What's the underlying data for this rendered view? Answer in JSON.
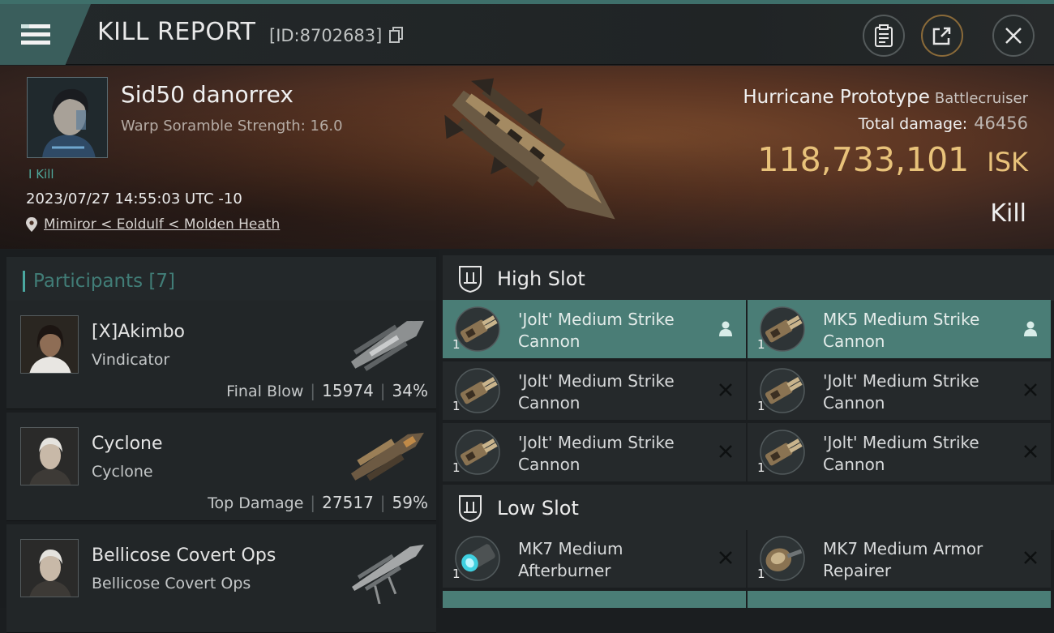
{
  "header": {
    "title": "KILL REPORT",
    "report_id": "[ID:8702683]",
    "icons": [
      "menu-icon",
      "copy-icon",
      "clipboard-icon",
      "share-icon",
      "close-icon"
    ]
  },
  "victim": {
    "name": "Sid50 danorrex",
    "scramble": "Warp Soramble Strength: 16.0",
    "kill_count": "I Kill",
    "time": "2023/07/27 14:55:03 UTC -10",
    "location": "Mimiror < Eoldulf < Molden Heath",
    "ship_name": "Hurricane Prototype",
    "ship_class": "Battlecruiser",
    "total_damage_label": "Total damage:",
    "total_damage": "46456",
    "isk_value": "118,733,101",
    "isk_unit": "ISK",
    "result": "Kill"
  },
  "participants": {
    "title": "Participants [7]",
    "rows": [
      {
        "name": "[X]Akimbo",
        "ship": "Vindicator",
        "label": "Final Blow",
        "damage": "15974",
        "pct": "34%"
      },
      {
        "name": "Cyclone",
        "ship": "Cyclone",
        "label": "Top Damage",
        "damage": "27517",
        "pct": "59%"
      },
      {
        "name": "Bellicose Covert Ops",
        "ship": "Bellicose Covert Ops"
      }
    ]
  },
  "slots": {
    "high": {
      "label": "High Slot",
      "modules": [
        {
          "qty": "1",
          "line1": "'Jolt' Medium Strike",
          "line2": "Cannon",
          "flag": "person-icon"
        },
        {
          "qty": "1",
          "line1": "MK5 Medium Strike",
          "line2": "Cannon",
          "flag": "person-icon"
        },
        {
          "qty": "1",
          "line1": "'Jolt' Medium Strike",
          "line2": "Cannon",
          "flag": "destroyed-x-icon"
        },
        {
          "qty": "1",
          "line1": "'Jolt' Medium Strike",
          "line2": "Cannon",
          "flag": "destroyed-x-icon"
        },
        {
          "qty": "1",
          "line1": "'Jolt' Medium Strike",
          "line2": "Cannon",
          "flag": "destroyed-x-icon"
        },
        {
          "qty": "1",
          "line1": "'Jolt' Medium Strike",
          "line2": "Cannon",
          "flag": "destroyed-x-icon"
        }
      ]
    },
    "low": {
      "label": "Low Slot",
      "modules": [
        {
          "qty": "1",
          "line1": "MK7 Medium",
          "line2": "Afterburner",
          "flag": "destroyed-x-icon"
        },
        {
          "qty": "1",
          "line1": "MK7 Medium Armor",
          "line2": "Repairer",
          "flag": "destroyed-x-icon"
        }
      ]
    }
  },
  "colors": {
    "accent": "#4a7d76",
    "isk": "#e8c27a",
    "header_stripe": "#3e6f6a"
  }
}
